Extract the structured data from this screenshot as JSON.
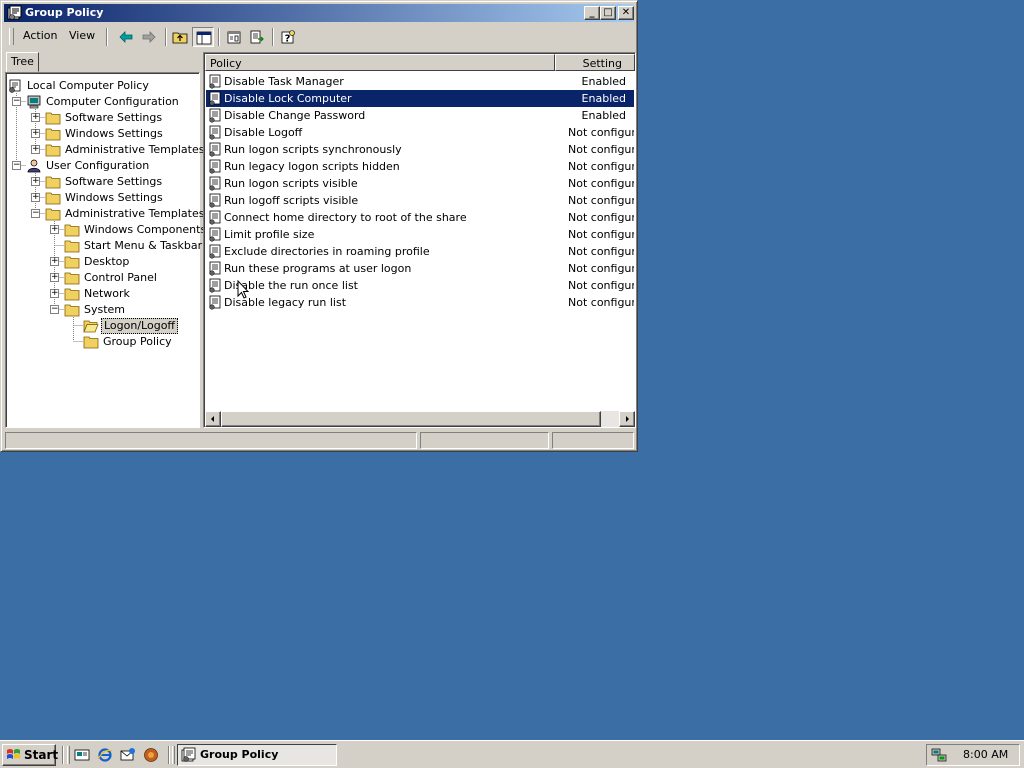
{
  "window": {
    "title": "Group Policy",
    "controls": {
      "minimize": "_",
      "maximize": "□",
      "close": "✕"
    }
  },
  "menu": {
    "action": "Action",
    "view": "View"
  },
  "toolbar": {
    "icons": [
      "back-arrow-icon",
      "forward-arrow-icon",
      "up-one-level-icon",
      "show-hide-tree-icon",
      "properties-icon",
      "export-list-icon",
      "help-icon"
    ]
  },
  "tree": {
    "tab_label": "Tree",
    "root": "Local Computer Policy",
    "computer_config": "Computer Configuration",
    "cc_software": "Software Settings",
    "cc_windows": "Windows Settings",
    "cc_admin": "Administrative Templates",
    "user_config": "User Configuration",
    "uc_software": "Software Settings",
    "uc_windows": "Windows Settings",
    "uc_admin": "Administrative Templates",
    "windows_components": "Windows Components",
    "start_menu": "Start Menu & Taskbar",
    "desktop": "Desktop",
    "control_panel": "Control Panel",
    "network": "Network",
    "system": "System",
    "logon_logoff": "Logon/Logoff",
    "group_policy": "Group Policy"
  },
  "list": {
    "col_policy": "Policy",
    "col_setting": "Setting",
    "selected_index": 1,
    "rows": [
      {
        "policy": "Disable Task Manager",
        "setting": "Enabled"
      },
      {
        "policy": "Disable Lock Computer",
        "setting": "Enabled"
      },
      {
        "policy": "Disable Change Password",
        "setting": "Enabled"
      },
      {
        "policy": "Disable Logoff",
        "setting": "Not configured"
      },
      {
        "policy": "Run logon scripts synchronously",
        "setting": "Not configured"
      },
      {
        "policy": "Run legacy logon scripts hidden",
        "setting": "Not configured"
      },
      {
        "policy": "Run logon scripts visible",
        "setting": "Not configured"
      },
      {
        "policy": "Run logoff scripts visible",
        "setting": "Not configured"
      },
      {
        "policy": "Connect home directory to root of the share",
        "setting": "Not configured"
      },
      {
        "policy": "Limit profile size",
        "setting": "Not configured"
      },
      {
        "policy": "Exclude directories in roaming profile",
        "setting": "Not configured"
      },
      {
        "policy": "Run these programs at user logon",
        "setting": "Not configured"
      },
      {
        "policy": "Disable the run once list",
        "setting": "Not configured"
      },
      {
        "policy": "Disable legacy run list",
        "setting": "Not configured"
      }
    ]
  },
  "taskbar": {
    "start_label": "Start",
    "task_label": "Group Policy",
    "clock": "8:00 AM",
    "quicklaunch": [
      "show-desktop-icon",
      "internet-explorer-icon",
      "outlook-express-icon",
      "media-player-icon"
    ]
  },
  "colors": {
    "desktop": "#3a6ea5",
    "title_active": "#0a246a",
    "selection": "#0a246a",
    "face": "#d4d0c8"
  }
}
